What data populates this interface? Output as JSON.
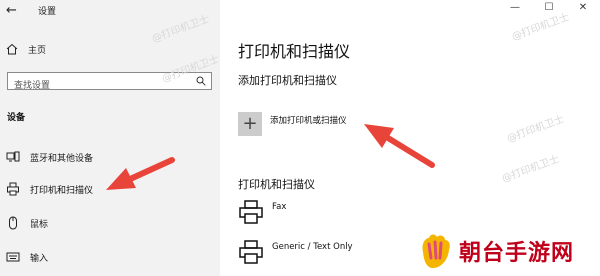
{
  "window": {
    "title": "设置",
    "back_icon": "back-arrow-icon",
    "controls": [
      "—",
      "☐",
      "✕"
    ]
  },
  "sidebar": {
    "home_label": "主页",
    "search_placeholder": "查找设置",
    "section_header": "设备",
    "items": [
      {
        "label": "蓝牙和其他设备",
        "icon": "bluetooth-devices-icon"
      },
      {
        "label": "打印机和扫描仪",
        "icon": "printer-icon",
        "active": true
      },
      {
        "label": "鼠标",
        "icon": "mouse-icon"
      },
      {
        "label": "输入",
        "icon": "keyboard-icon"
      }
    ]
  },
  "main": {
    "title": "打印机和扫描仪",
    "add_section_title": "添加打印机和扫描仪",
    "add_button_label": "添加打印机或扫描仪",
    "printers_section_title": "打印机和扫描仪",
    "printers": [
      {
        "name": "Fax"
      },
      {
        "name": "Generic / Text Only"
      }
    ]
  },
  "watermark": {
    "text": "@打印机卫士"
  },
  "brand": {
    "text": "朝台手游网"
  },
  "colors": {
    "sidebar_bg": "#f2f2f2",
    "arrow": "#e8443a",
    "brand": "#c0001a",
    "add_button_bg": "#cccccc"
  }
}
